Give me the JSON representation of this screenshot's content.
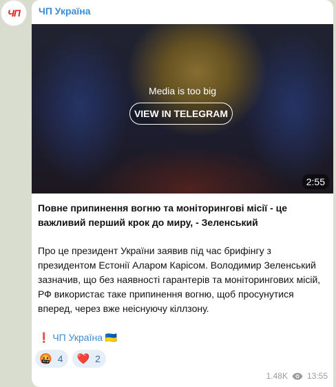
{
  "channel": {
    "avatar_label": "ЧП",
    "name": "ЧП Україна"
  },
  "media": {
    "message": "Media is too big",
    "button_label": "VIEW IN TELEGRAM",
    "duration": "2:55"
  },
  "post": {
    "headline": "Повне припинення вогню та моніторингові місії - це важливий перший крок до миру, - Зеленський",
    "body": "Про це президент України заявив під час брифінгу з президентом Естонії Аларом Карісом. Володимир Зеленський зазначив, що без наявності гарантерів та моніторингових місій, РФ використає таке припинення вогню, щоб просунутися вперед, через вже неіснуючу кіллзону.",
    "footer_prefix": "❗️",
    "footer_link": "ЧП Україна",
    "footer_suffix": "🇺🇦"
  },
  "reactions": [
    {
      "emoji": "🤬",
      "count": "4"
    },
    {
      "emoji": "❤️",
      "count": "2"
    }
  ],
  "meta": {
    "views": "1.48K",
    "time": "13:55",
    "icon": "eye-icon"
  },
  "colors": {
    "accent": "#3a8bd6",
    "background": "#d9ddd0",
    "avatar_text": "#e02020"
  }
}
